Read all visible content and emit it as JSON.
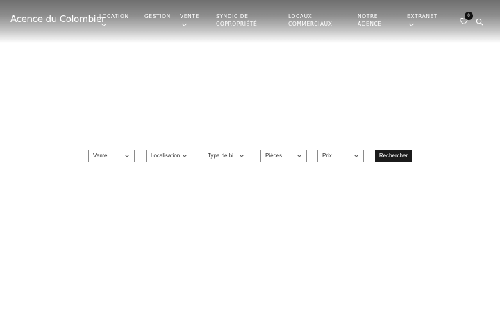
{
  "header": {
    "logo": "Acence du Colombier",
    "nav": [
      {
        "line1": "LOCATION",
        "line2": "",
        "dropdown": true
      },
      {
        "line1": "GESTION",
        "line2": "",
        "dropdown": false
      },
      {
        "line1": "VENTE",
        "line2": "",
        "dropdown": true
      },
      {
        "line1": "SYNDIC DE",
        "line2": "COPROPRIÉTÉ",
        "dropdown": false
      },
      {
        "line1": "LOCAUX",
        "line2": "COMMERCIAUX",
        "dropdown": false
      },
      {
        "line1": "NOTRE",
        "line2": "AGENCE",
        "dropdown": false
      },
      {
        "line1": "EXTRANET",
        "line2": "",
        "dropdown": true
      }
    ],
    "favorites_count": "0"
  },
  "search_form": {
    "filters": [
      {
        "label": "Vente"
      },
      {
        "label": "Localisation"
      },
      {
        "label": "Type de bi..."
      },
      {
        "label": "Pièces"
      },
      {
        "label": "Prix"
      }
    ],
    "submit_label": "Rechercher"
  },
  "colors": {
    "accent": "#1b1b1b",
    "header_top": "#6f6f6f",
    "text_light": "#ffffff"
  }
}
